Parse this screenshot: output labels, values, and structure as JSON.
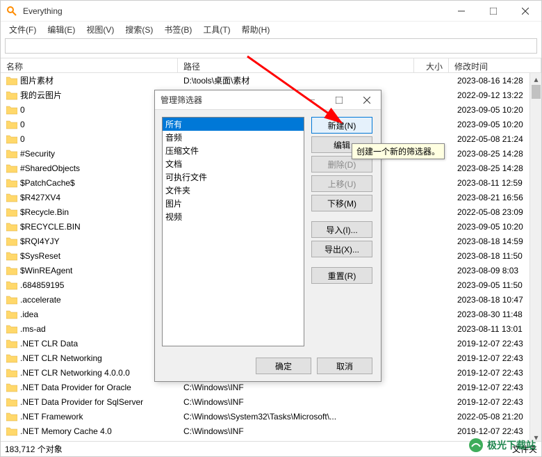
{
  "titlebar": {
    "title": "Everything"
  },
  "menubar": {
    "items": [
      "文件(F)",
      "编辑(E)",
      "视图(V)",
      "搜索(S)",
      "书签(B)",
      "工具(T)",
      "帮助(H)"
    ]
  },
  "search": {
    "value": ""
  },
  "columns": {
    "name": "名称",
    "path": "路径",
    "size": "大小",
    "date": "修改时间"
  },
  "rows": [
    {
      "name": "图片素材",
      "path": "D:\\tools\\桌面\\素材",
      "date": "2023-08-16 14:28"
    },
    {
      "name": "我的云图片",
      "path": "",
      "date": "2022-09-12 13:22"
    },
    {
      "name": "0",
      "path": "",
      "date": "2023-09-05 10:20"
    },
    {
      "name": "0",
      "path": "",
      "date": "2023-09-05 10:20"
    },
    {
      "name": "0",
      "path": "",
      "date": "2022-05-08 21:24"
    },
    {
      "name": "#Security",
      "path": "",
      "date": "2023-08-25 14:28",
      "truncated_left": true
    },
    {
      "name": "#SharedObjects",
      "path": "",
      "date": "2023-08-25 14:28"
    },
    {
      "name": "$PatchCache$",
      "path": "",
      "date": "2023-08-11 12:59"
    },
    {
      "name": "$R427XV4",
      "path": "",
      "date": "2023-08-21 16:56"
    },
    {
      "name": "$Recycle.Bin",
      "path": "",
      "date": "2022-05-08 23:09"
    },
    {
      "name": "$RECYCLE.BIN",
      "path": "",
      "date": "2023-09-05 10:20"
    },
    {
      "name": "$RQI4YJY",
      "path": "",
      "date": "2023-08-18 14:59"
    },
    {
      "name": "$SysReset",
      "path": "",
      "date": "2023-08-18 11:50"
    },
    {
      "name": "$WinREAgent",
      "path": "",
      "date": "2023-08-09 8:03"
    },
    {
      "name": ".684859195",
      "path": "",
      "date": "2023-09-05 11:50"
    },
    {
      "name": ".accelerate",
      "path": "",
      "date": "2023-08-18 10:47"
    },
    {
      "name": ".idea",
      "path": "",
      "date": "2023-08-30 11:48"
    },
    {
      "name": ".ms-ad",
      "path": "",
      "date": "2023-08-11 13:01"
    },
    {
      "name": ".NET CLR Data",
      "path": "C:\\Windows\\INF",
      "date": "2019-12-07 22:43"
    },
    {
      "name": ".NET CLR Networking",
      "path": "C:\\Windows\\INF",
      "date": "2019-12-07 22:43"
    },
    {
      "name": ".NET CLR Networking 4.0.0.0",
      "path": "C:\\Windows\\INF",
      "date": "2019-12-07 22:43"
    },
    {
      "name": ".NET Data Provider for Oracle",
      "path": "C:\\Windows\\INF",
      "date": "2019-12-07 22:43"
    },
    {
      "name": ".NET Data Provider for SqlServer",
      "path": "C:\\Windows\\INF",
      "date": "2019-12-07 22:43"
    },
    {
      "name": ".NET Framework",
      "path": "C:\\Windows\\System32\\Tasks\\Microsoft\\...",
      "date": "2022-05-08 21:20"
    },
    {
      "name": ".NET Memory Cache 4.0",
      "path": "C:\\Windows\\INF",
      "date": "2019-12-07 22:43"
    }
  ],
  "status": {
    "left": "183,712 个对象",
    "right": "文件夹"
  },
  "dialog": {
    "title": "管理筛选器",
    "items": [
      "所有",
      "音频",
      "压缩文件",
      "文档",
      "可执行文件",
      "文件夹",
      "图片",
      "视频"
    ],
    "selected_index": 0,
    "buttons": {
      "new": "新建(N)",
      "edit": "编辑",
      "delete": "删除(D)",
      "moveup": "上移(U)",
      "movedown": "下移(M)",
      "import": "导入(I)...",
      "export": "导出(X)...",
      "reset": "重置(R)"
    },
    "footer": {
      "ok": "确定",
      "cancel": "取消"
    }
  },
  "tooltip": "创建一个新的筛选器。",
  "watermark": "极光下载站"
}
